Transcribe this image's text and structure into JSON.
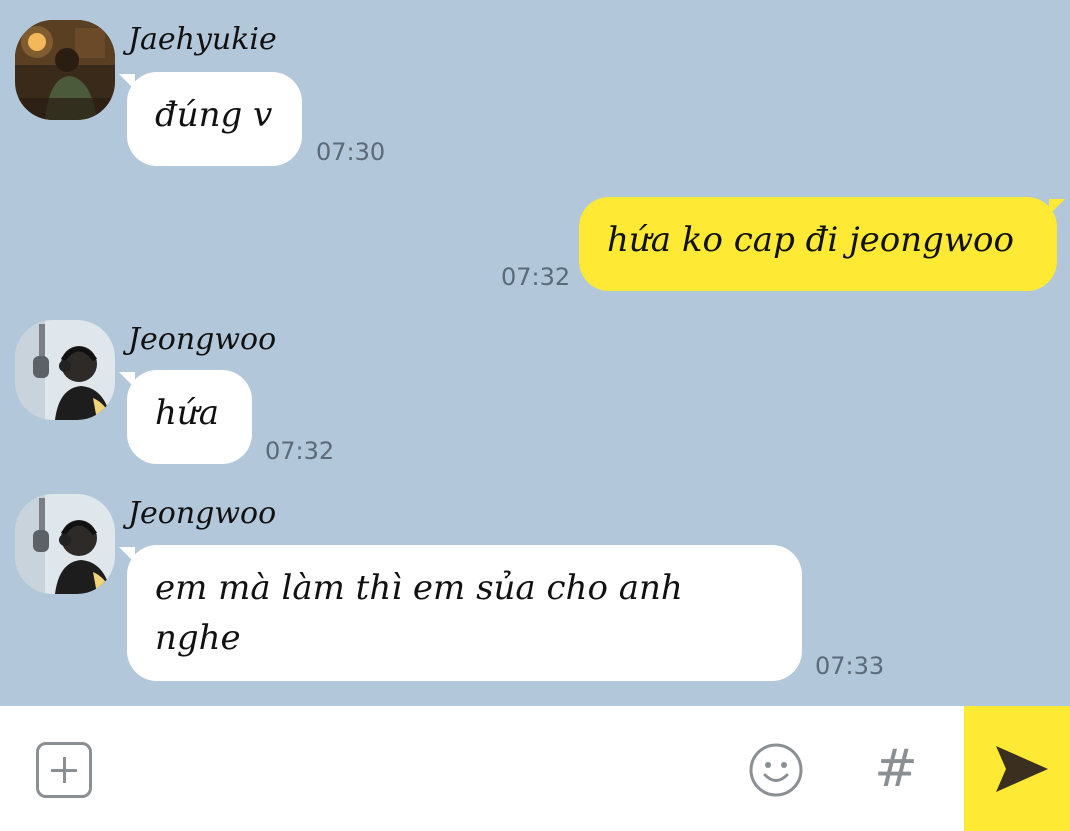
{
  "messages": [
    {
      "direction": "in",
      "sender": "Jaehyukie",
      "avatar": "jaehyukie-avatar",
      "text": "đúng v",
      "time": "07:30"
    },
    {
      "direction": "out",
      "text": "hứa ko cap đi jeongwoo",
      "time": "07:32"
    },
    {
      "direction": "in",
      "sender": "Jeongwoo",
      "avatar": "jeongwoo-avatar",
      "text": "hứa",
      "time": "07:32"
    },
    {
      "direction": "in",
      "sender": "Jeongwoo",
      "avatar": "jeongwoo-avatar",
      "text": "em mà làm thì em sủa cho anh nghe",
      "time": "07:33"
    }
  ],
  "input_bar": {
    "add_icon": "plus-square-icon",
    "emoji_icon": "smiley-icon",
    "hashtag_label": "#",
    "send_icon": "send-arrow-icon"
  },
  "colors": {
    "chat_background": "#b2c7da",
    "outgoing_bubble": "#fee934",
    "incoming_bubble": "#ffffff",
    "send_button": "#fee934"
  }
}
